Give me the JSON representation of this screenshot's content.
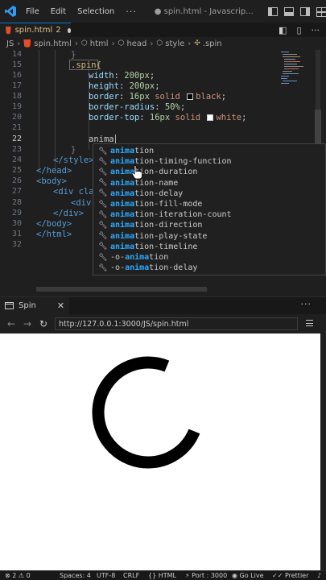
{
  "titlebar": {
    "menus": [
      "File",
      "Edit",
      "Selection"
    ],
    "more": "···",
    "title": "● spin.html - Javascrip..."
  },
  "tab": {
    "filename": "spin.html",
    "problems": "2"
  },
  "breadcrumb": [
    "JS",
    "spin.html",
    "html",
    "head",
    "style",
    ".spin"
  ],
  "editor": {
    "lines": [
      {
        "n": "14",
        "text": "}"
      },
      {
        "n": "15",
        "text": ".spin{"
      },
      {
        "n": "16",
        "prop": "width",
        "num": "200",
        "unit": "px"
      },
      {
        "n": "17",
        "prop": "height",
        "num": "200",
        "unit": "px"
      },
      {
        "n": "18",
        "prop": "border",
        "num": "16",
        "unit": "px",
        "rest1": "solid",
        "rest2": "black"
      },
      {
        "n": "19",
        "prop": "border-radius",
        "num": "50",
        "unit": "%"
      },
      {
        "n": "20",
        "prop": "border-top",
        "num": "16",
        "unit": "px",
        "rest1": "solid",
        "rest2": "white"
      },
      {
        "n": "21",
        "text": ""
      },
      {
        "n": "22",
        "text": "anima"
      },
      {
        "n": "23",
        "text": "}"
      },
      {
        "n": "24",
        "text": "</style>"
      },
      {
        "n": "25",
        "text": "</head>"
      },
      {
        "n": "26",
        "text": "<body>"
      },
      {
        "n": "27",
        "text": "<div class"
      },
      {
        "n": "28",
        "text": "<div c"
      },
      {
        "n": "29",
        "text": "</div>"
      },
      {
        "n": "30",
        "text": "</body>"
      },
      {
        "n": "31",
        "text": "</html>"
      },
      {
        "n": "32",
        "text": ""
      }
    ]
  },
  "suggestions": [
    {
      "match": "anima",
      "rest": "tion"
    },
    {
      "match": "anima",
      "rest": "tion-timing-function"
    },
    {
      "match": "anima",
      "rest": "tion-duration"
    },
    {
      "match": "anima",
      "rest": "tion-name"
    },
    {
      "match": "anima",
      "rest": "tion-delay"
    },
    {
      "match": "anima",
      "rest": "tion-fill-mode"
    },
    {
      "match": "anima",
      "rest": "tion-iteration-count"
    },
    {
      "match": "anima",
      "rest": "tion-direction"
    },
    {
      "match": "anima",
      "rest": "tion-play-state"
    },
    {
      "match": "anima",
      "rest": "tion-timeline"
    },
    {
      "prefix": "-o-",
      "match": "anima",
      "rest": "tion"
    },
    {
      "prefix": "-o-",
      "match": "anima",
      "rest": "tion-delay"
    }
  ],
  "browser": {
    "tab_label": "Spin",
    "url": "http://127.0.0.1:3000/JS/spin.html"
  },
  "statusbar": {
    "errors": "2",
    "warnings": "0",
    "spaces": "Spaces: 4",
    "encoding": "UTF-8",
    "eol": "CRLF",
    "language": "HTML",
    "port": "Port : 3000",
    "golive": "Go Live",
    "prettier": "Prettier"
  },
  "colors": {
    "accent": "#0078d4",
    "suggest_match": "#2aaaff",
    "selected_row": "#04395e"
  }
}
